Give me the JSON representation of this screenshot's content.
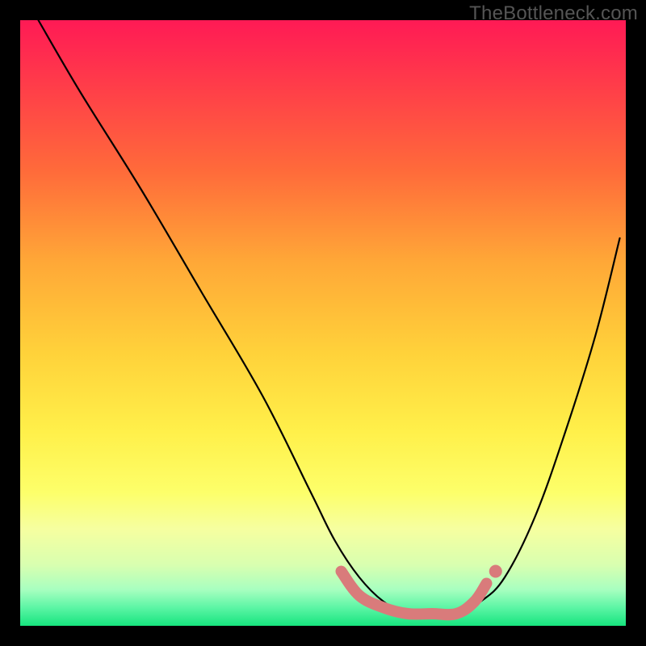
{
  "watermark": "TheBottleneck.com",
  "chart_data": {
    "type": "line",
    "title": "",
    "xlabel": "",
    "ylabel": "",
    "xlim": [
      0,
      100
    ],
    "ylim": [
      0,
      100
    ],
    "series": [
      {
        "name": "curve",
        "x": [
          3,
          10,
          20,
          30,
          40,
          48,
          52,
          56,
          60,
          64,
          68,
          72,
          76,
          80,
          85,
          90,
          95,
          99
        ],
        "y": [
          100,
          88,
          72,
          55,
          38,
          22,
          14,
          8,
          4,
          2,
          2,
          2,
          4,
          8,
          18,
          32,
          48,
          64
        ]
      }
    ],
    "highlight_segment": {
      "x": [
        53,
        56,
        60,
        64,
        68,
        72,
        75,
        77
      ],
      "y": [
        9,
        5,
        3,
        2,
        2,
        2,
        4,
        7
      ]
    },
    "colors": {
      "curve": "#000000",
      "highlight": "#d97b7b"
    }
  }
}
